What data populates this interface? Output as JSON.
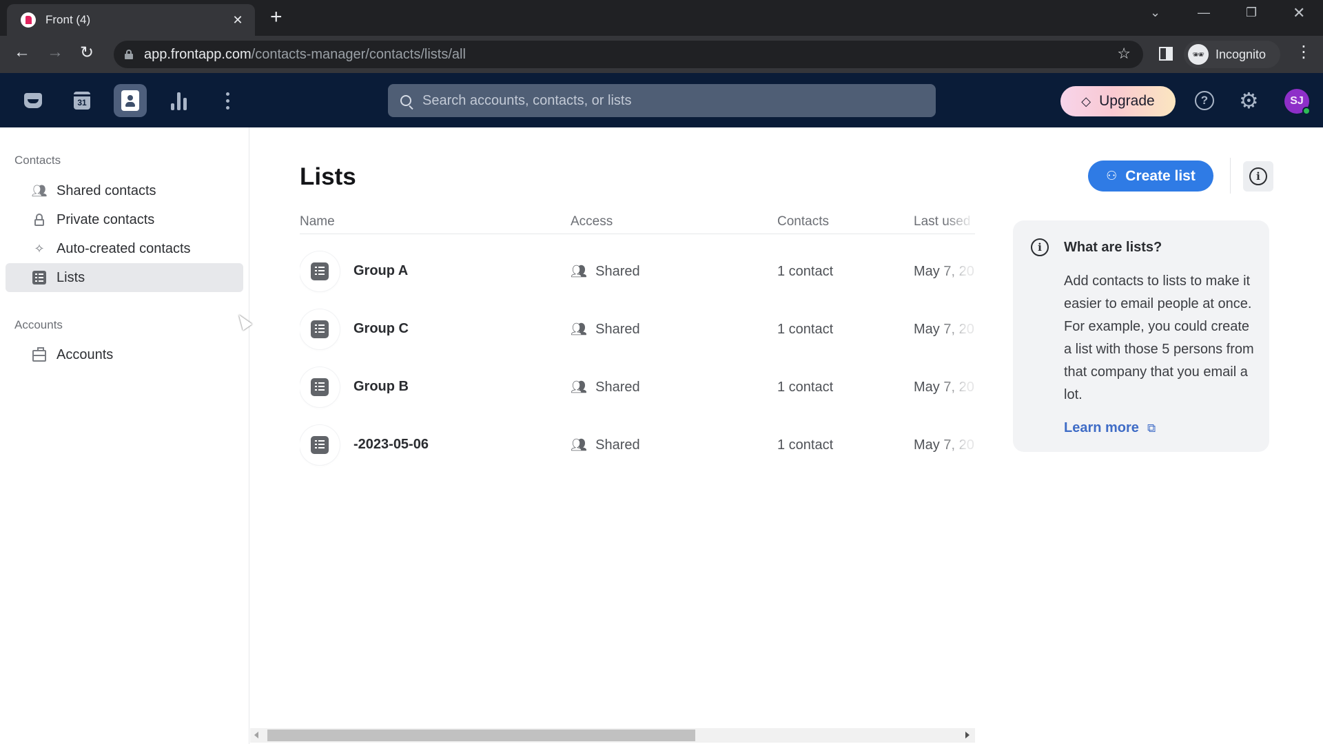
{
  "browser": {
    "tab_title": "Front (4)",
    "url_host": "app.frontapp.com",
    "url_path": "/contacts-manager/contacts/lists/all",
    "profile_label": "Incognito"
  },
  "appbar": {
    "nav_icons": [
      "inbox-icon",
      "calendar-icon",
      "contacts-icon",
      "analytics-icon",
      "more-icon"
    ],
    "calendar_day": "31",
    "active_nav": "contacts-icon",
    "search_placeholder": "Search accounts, contacts, or lists",
    "upgrade_label": "Upgrade",
    "avatar_initials": "SJ",
    "avatar_color": "#8e2fc8",
    "presence_color": "#2dbb55"
  },
  "sidebar": {
    "sections": [
      {
        "title": "Contacts",
        "items": [
          {
            "label": "Shared contacts",
            "icon": "users-icon",
            "active": false
          },
          {
            "label": "Private contacts",
            "icon": "lock-icon",
            "active": false
          },
          {
            "label": "Auto-created contacts",
            "icon": "sparkles-icon",
            "active": false
          },
          {
            "label": "Lists",
            "icon": "list-icon",
            "active": true
          }
        ]
      },
      {
        "title": "Accounts",
        "items": [
          {
            "label": "Accounts",
            "icon": "briefcase-icon",
            "active": false
          }
        ]
      }
    ]
  },
  "main": {
    "title": "Lists",
    "create_label": "Create list",
    "accent_color": "#2f7be5",
    "table": {
      "columns": [
        "Name",
        "Access",
        "Contacts",
        "Last used"
      ],
      "rows": [
        {
          "name": "Group A",
          "access": "Shared",
          "contacts": "1 contact",
          "last_used": "May 7, 20"
        },
        {
          "name": "Group C",
          "access": "Shared",
          "contacts": "1 contact",
          "last_used": "May 7, 20"
        },
        {
          "name": "Group B",
          "access": "Shared",
          "contacts": "1 contact",
          "last_used": "May 7, 20"
        },
        {
          "name": "-2023-05-06",
          "access": "Shared",
          "contacts": "1 contact",
          "last_used": "May 7, 20"
        }
      ]
    },
    "info_panel": {
      "title": "What are lists?",
      "body": "Add contacts to lists to make it easier to email people at once. For example, you could create a list with those 5 persons from that company that you email a lot.",
      "link_label": "Learn more"
    },
    "hscroll": {
      "visible_fraction": 0.62,
      "position": 0
    }
  }
}
